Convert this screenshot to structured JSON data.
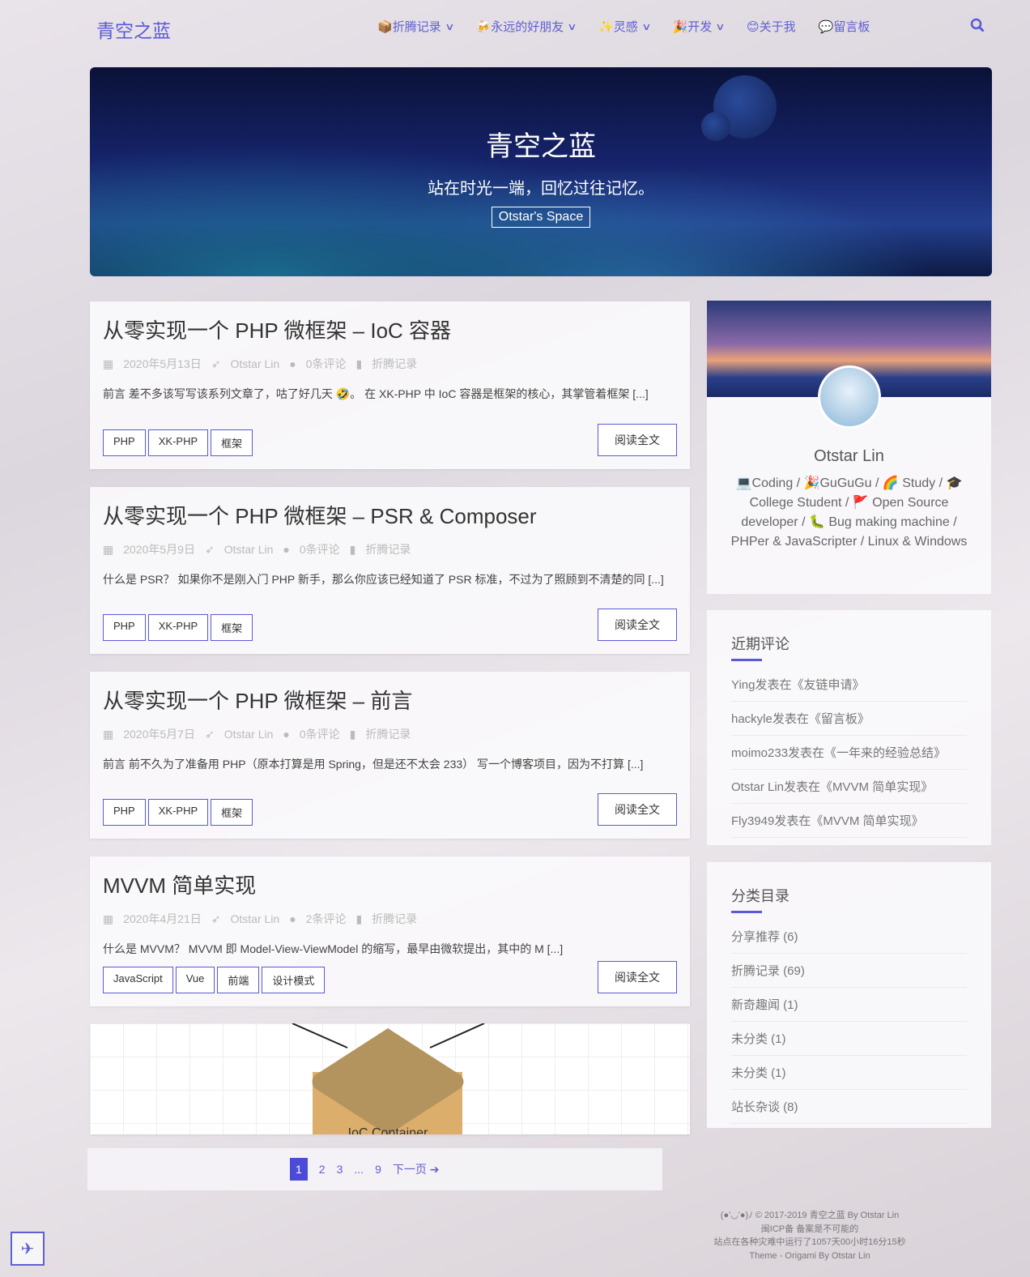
{
  "site": {
    "logo": "青空之蓝",
    "accent": "#5a5ad8"
  },
  "nav": {
    "items": [
      {
        "icon": "📦",
        "label": "折腾记录",
        "dropdown": true
      },
      {
        "icon": "🍻",
        "label": "永远的好朋友",
        "dropdown": true
      },
      {
        "icon": "✨",
        "label": "灵感",
        "dropdown": true
      },
      {
        "icon": "🎉",
        "label": "开发",
        "dropdown": true
      },
      {
        "icon": "😊",
        "label": "关于我",
        "dropdown": false
      },
      {
        "icon": "💬",
        "label": "留言板",
        "dropdown": false
      }
    ],
    "search_icon": "search-icon"
  },
  "hero": {
    "title": "青空之蓝",
    "subtitle": "站在时光一端，回忆过往记忆。",
    "button": "Otstar's Space"
  },
  "posts": [
    {
      "title": "从零实现一个 PHP 微框架 – IoC 容器",
      "date": "2020年5月13日",
      "author": "Otstar Lin",
      "comments": "0条评论",
      "category": "折腾记录",
      "excerpt": "前言 差不多该写写该系列文章了，咕了好几天 🤣。 在 XK-PHP 中 IoC 容器是框架的核心，其掌管着框架 [...]",
      "tags": [
        "PHP",
        "XK-PHP",
        "框架"
      ],
      "read": "阅读全文"
    },
    {
      "title": "从零实现一个 PHP 微框架 – PSR & Composer",
      "date": "2020年5月9日",
      "author": "Otstar Lin",
      "comments": "0条评论",
      "category": "折腾记录",
      "excerpt": "什么是 PSR？ 如果你不是刚入门 PHP 新手，那么你应该已经知道了 PSR 标准，不过为了照顾到不清楚的同 [...]",
      "tags": [
        "PHP",
        "XK-PHP",
        "框架"
      ],
      "read": "阅读全文"
    },
    {
      "title": "从零实现一个 PHP 微框架 – 前言",
      "date": "2020年5月7日",
      "author": "Otstar Lin",
      "comments": "0条评论",
      "category": "折腾记录",
      "excerpt": "前言 前不久为了准备用 PHP（原本打算是用 Spring，但是还不太会 233） 写一个博客项目，因为不打算 [...]",
      "tags": [
        "PHP",
        "XK-PHP",
        "框架"
      ],
      "read": "阅读全文"
    },
    {
      "title": "MVVM 简单实现",
      "date": "2020年4月21日",
      "author": "Otstar Lin",
      "comments": "2条评论",
      "category": "折腾记录",
      "excerpt": "什么是 MVVM？ MVVM 即 Model-View-ViewModel 的缩写，最早由微软提出，其中的 M [...]",
      "tags": [
        "JavaScript",
        "Vue",
        "前端",
        "设计模式"
      ],
      "read": "阅读全文"
    }
  ],
  "featured_image": {
    "label": "IoC Container"
  },
  "profile": {
    "name": "Otstar Lin",
    "bio": "💻Coding / 🎉GuGuGu / 🌈 Study / 🎓 College Student / 🚩 Open Source developer / 🐛 Bug making machine / PHPer & JavaScripter / Linux & Windows"
  },
  "recent_comments": {
    "title": "近期评论",
    "items": [
      "Ying发表在《友链申请》",
      "hackyle发表在《留言板》",
      "moimo233发表在《一年来的经验总结》",
      "Otstar Lin发表在《MVVM 简单实现》",
      "Fly3949发表在《MVVM 简单实现》"
    ]
  },
  "categories": {
    "title": "分类目录",
    "items": [
      "分享推荐 (6)",
      "折腾记录 (69)",
      "新奇趣闻 (1)",
      "未分类 (1)",
      "未分类 (1)",
      "站长杂谈 (8)"
    ]
  },
  "pagination": {
    "pages": [
      "1",
      "2",
      "3",
      "...",
      "9"
    ],
    "current": "1",
    "next": "下一页 ➔"
  },
  "footer": {
    "lines": [
      "(●'◡'●)ﾉ  © 2017-2019 青空之蓝 By Otstar Lin",
      "闽ICP备 备案是不可能的",
      "站点在各种灾难中运行了1057天00小时16分15秒",
      "Theme - Origami By Otstar Lin"
    ]
  }
}
